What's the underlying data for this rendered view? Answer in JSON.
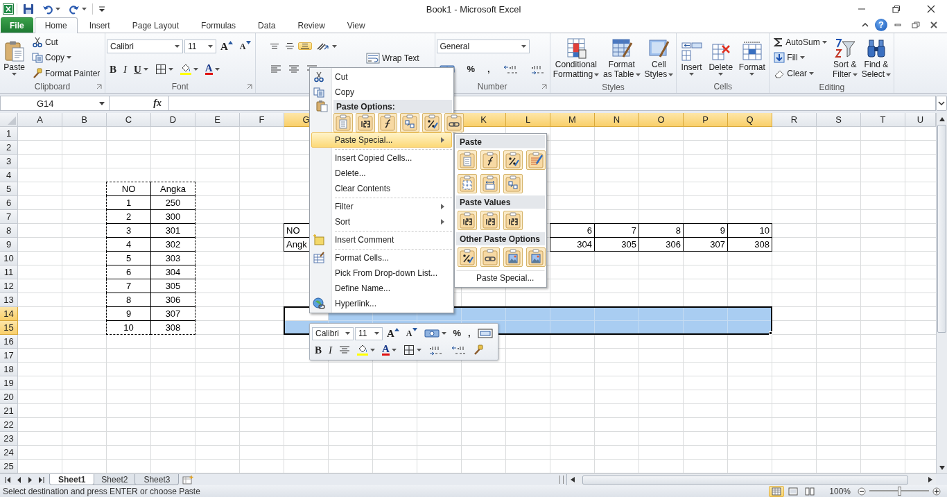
{
  "title_bar": {
    "title": "Book1  -  Microsoft Excel"
  },
  "ribbon_tabs": [
    {
      "label": "File",
      "kind": "file",
      "selected": false
    },
    {
      "label": "Home",
      "kind": "tab",
      "selected": true
    },
    {
      "label": "Insert",
      "kind": "tab",
      "selected": false
    },
    {
      "label": "Page Layout",
      "kind": "tab",
      "selected": false
    },
    {
      "label": "Formulas",
      "kind": "tab",
      "selected": false
    },
    {
      "label": "Data",
      "kind": "tab",
      "selected": false
    },
    {
      "label": "Review",
      "kind": "tab",
      "selected": false
    },
    {
      "label": "View",
      "kind": "tab",
      "selected": false
    }
  ],
  "help_button": "?",
  "ribbon_groups": [
    {
      "label": "Clipboard",
      "launcher": true,
      "columns": [
        [
          [
            {
              "kind": "large",
              "lines": [
                "Paste"
              ],
              "caret": true
            }
          ]
        ],
        [
          [
            {
              "kind": "small",
              "label": "Cut"
            }
          ],
          [
            {
              "kind": "small",
              "label": "Copy",
              "caret": true
            }
          ],
          [
            {
              "kind": "small",
              "label": "Format Painter"
            }
          ]
        ]
      ]
    },
    {
      "label": "Font",
      "launcher": true,
      "columns": [
        [
          [
            {
              "kind": "combo",
              "value": "Calibri"
            },
            {
              "kind": "combo",
              "value": "11"
            },
            {
              "kind": "glyph",
              "label": "A"
            },
            {
              "kind": "glyph",
              "label": "A"
            }
          ],
          [
            {
              "kind": "glyph",
              "label": "B"
            },
            {
              "kind": "glyph",
              "label": "I"
            },
            {
              "kind": "glyph",
              "label": "U",
              "caret": true
            },
            {
              "kind": "icon",
              "caret": true
            },
            {
              "kind": "icon",
              "caret": true
            },
            {
              "kind": "glyph",
              "label": "A",
              "caret": true
            }
          ]
        ]
      ]
    },
    {
      "columns": [
        [
          [
            {
              "kind": "icon",
              "selected": false
            },
            {
              "kind": "icon",
              "selected": false
            },
            {
              "kind": "icon",
              "selected": true
            },
            {
              "kind": "icon",
              "caret": true
            }
          ],
          [
            {
              "kind": "icon"
            },
            {
              "kind": "icon"
            },
            {
              "kind": "icon"
            }
          ]
        ],
        [
          [
            {
              "kind": "small",
              "label": "Wrap Text"
            }
          ]
        ]
      ]
    },
    {
      "label": "Number",
      "launcher": true,
      "columns": [
        [
          [
            {
              "kind": "combo",
              "value": "General"
            }
          ],
          [
            {
              "kind": "icon"
            },
            {
              "kind": "glyph",
              "label": "%"
            },
            {
              "kind": "glyph",
              "label": ","
            },
            {
              "kind": "icon"
            },
            {
              "kind": "icon"
            }
          ]
        ]
      ]
    },
    {
      "label": "Styles",
      "columns": [
        [
          [
            {
              "kind": "large",
              "lines": [
                "Conditional",
                "Formatting"
              ],
              "caret": true
            }
          ]
        ],
        [
          [
            {
              "kind": "large",
              "lines": [
                "Format",
                "as Table"
              ],
              "caret": true
            }
          ]
        ],
        [
          [
            {
              "kind": "large",
              "lines": [
                "Cell",
                "Styles"
              ],
              "caret": true
            }
          ]
        ]
      ]
    },
    {
      "label": "Cells",
      "columns": [
        [
          [
            {
              "kind": "large",
              "lines": [
                "Insert"
              ],
              "caret": true
            }
          ]
        ],
        [
          [
            {
              "kind": "large",
              "lines": [
                "Delete"
              ],
              "caret": true
            }
          ]
        ],
        [
          [
            {
              "kind": "large",
              "lines": [
                "Format"
              ],
              "caret": true
            }
          ]
        ]
      ]
    },
    {
      "label": "Editing",
      "columns": [
        [
          [
            {
              "kind": "small",
              "label": "AutoSum",
              "caret": true
            }
          ],
          [
            {
              "kind": "small",
              "label": "Fill",
              "caret": true
            }
          ],
          [
            {
              "kind": "small",
              "label": "Clear",
              "caret": true
            }
          ]
        ],
        [
          [
            {
              "kind": "large",
              "lines": [
                "Sort &",
                "Filter"
              ],
              "caret": true
            }
          ]
        ],
        [
          [
            {
              "kind": "large",
              "lines": [
                "Find &",
                "Select"
              ],
              "caret": true
            }
          ]
        ]
      ]
    }
  ],
  "formula_bar": {
    "name_box": "G14",
    "function_button": "fx"
  },
  "sheet": {
    "columns": [
      {
        "kind": "header",
        "label": "A",
        "selected": false
      },
      {
        "kind": "header",
        "label": "B",
        "selected": false
      },
      {
        "kind": "header",
        "label": "C",
        "selected": false
      },
      {
        "kind": "header",
        "label": "D",
        "selected": false
      },
      {
        "kind": "header",
        "label": "E",
        "selected": false
      },
      {
        "kind": "header",
        "label": "F",
        "selected": false
      },
      {
        "kind": "header",
        "label": "G",
        "selected": true
      },
      {
        "kind": "covered",
        "selected": true
      },
      {
        "kind": "covered",
        "selected": true
      },
      {
        "kind": "covered",
        "selected": true
      },
      {
        "kind": "header",
        "label": "K",
        "selected": true
      },
      {
        "kind": "header",
        "label": "L",
        "selected": true
      },
      {
        "kind": "header",
        "label": "M",
        "selected": true
      },
      {
        "kind": "header",
        "label": "N",
        "selected": true
      },
      {
        "kind": "header",
        "label": "O",
        "selected": true
      },
      {
        "kind": "header",
        "label": "P",
        "selected": true
      },
      {
        "kind": "header",
        "label": "Q",
        "selected": true
      },
      {
        "kind": "header",
        "label": "R",
        "selected": false
      },
      {
        "kind": "header",
        "label": "S",
        "selected": false
      },
      {
        "kind": "header",
        "label": "T",
        "selected": false
      },
      {
        "kind": "header",
        "label": "U",
        "selected": false
      }
    ],
    "rows": [
      {
        "label": "1",
        "selected": false
      },
      {
        "label": "2",
        "selected": false
      },
      {
        "label": "3",
        "selected": false
      },
      {
        "label": "4",
        "selected": false
      },
      {
        "label": "5",
        "selected": false,
        "cells": {
          "C": {
            "value": "NO",
            "copied": true
          },
          "D": {
            "value": "Angka",
            "copied": true
          }
        }
      },
      {
        "label": "6",
        "selected": false,
        "cells": {
          "C": {
            "value": "1",
            "copied": true
          },
          "D": {
            "value": "250",
            "copied": true
          }
        }
      },
      {
        "label": "7",
        "selected": false,
        "cells": {
          "C": {
            "value": "2",
            "copied": true
          },
          "D": {
            "value": "300",
            "copied": true
          }
        }
      },
      {
        "label": "8",
        "selected": false,
        "cells": {
          "C": {
            "value": "3",
            "copied": true
          },
          "D": {
            "value": "301",
            "copied": true
          },
          "G": {
            "value": "NO"
          },
          "M": {
            "value": "6"
          },
          "N": {
            "value": "7"
          },
          "O": {
            "value": "8"
          },
          "P": {
            "value": "9"
          },
          "Q": {
            "value": "10"
          }
        }
      },
      {
        "label": "9",
        "selected": false,
        "cells": {
          "C": {
            "value": "4",
            "copied": true
          },
          "D": {
            "value": "302",
            "copied": true
          },
          "G": {
            "value": "Angk"
          },
          "M": {
            "value": "304"
          },
          "N": {
            "value": "305"
          },
          "O": {
            "value": "306"
          },
          "P": {
            "value": "307"
          },
          "Q": {
            "value": "308"
          }
        }
      },
      {
        "label": "10",
        "selected": false,
        "cells": {
          "C": {
            "value": "5",
            "copied": true
          },
          "D": {
            "value": "303",
            "copied": true
          }
        }
      },
      {
        "label": "11",
        "selected": false,
        "cells": {
          "C": {
            "value": "6",
            "copied": true
          },
          "D": {
            "value": "304",
            "copied": true
          }
        }
      },
      {
        "label": "12",
        "selected": false,
        "cells": {
          "C": {
            "value": "7",
            "copied": true
          },
          "D": {
            "value": "305",
            "copied": true
          }
        }
      },
      {
        "label": "13",
        "selected": false,
        "cells": {
          "C": {
            "value": "8",
            "copied": true
          },
          "D": {
            "value": "306",
            "copied": true
          }
        }
      },
      {
        "label": "14",
        "selected": true,
        "cells": {
          "C": {
            "value": "9",
            "copied": true
          },
          "D": {
            "value": "307",
            "copied": true
          }
        }
      },
      {
        "label": "15",
        "selected": true,
        "cells": {
          "C": {
            "value": "10",
            "copied": true
          },
          "D": {
            "value": "308",
            "copied": true
          }
        }
      },
      {
        "label": "16",
        "selected": false
      },
      {
        "label": "17",
        "selected": false
      },
      {
        "label": "18",
        "selected": false
      },
      {
        "label": "19",
        "selected": false
      },
      {
        "label": "20",
        "selected": false
      },
      {
        "label": "21",
        "selected": false
      },
      {
        "label": "22",
        "selected": false
      },
      {
        "label": "23",
        "selected": false
      },
      {
        "label": "24",
        "selected": false
      },
      {
        "label": "25",
        "selected": false
      }
    ]
  },
  "context_menu": {
    "items": [
      {
        "kind": "item",
        "label": "Cut",
        "selected": false
      },
      {
        "kind": "item",
        "label": "Copy",
        "selected": false
      },
      {
        "kind": "header",
        "label": "Paste Options:"
      },
      {
        "kind": "paste_icons"
      },
      {
        "kind": "item",
        "label": "Paste Special...",
        "selected": true,
        "submenu": true
      },
      {
        "kind": "separator"
      },
      {
        "kind": "item",
        "label": "Insert Copied Cells...",
        "selected": false
      },
      {
        "kind": "item",
        "label": "Delete...",
        "selected": false
      },
      {
        "kind": "item",
        "label": "Clear Contents",
        "selected": false
      },
      {
        "kind": "separator"
      },
      {
        "kind": "item",
        "label": "Filter",
        "selected": false,
        "submenu": true
      },
      {
        "kind": "item",
        "label": "Sort",
        "selected": false,
        "submenu": true
      },
      {
        "kind": "separator"
      },
      {
        "kind": "item",
        "label": "Insert Comment",
        "selected": false
      },
      {
        "kind": "separator"
      },
      {
        "kind": "item",
        "label": "Format Cells...",
        "selected": false
      },
      {
        "kind": "item",
        "label": "Pick From Drop-down List...",
        "selected": false
      },
      {
        "kind": "item",
        "label": "Define Name...",
        "selected": false
      },
      {
        "kind": "item",
        "label": "Hyperlink...",
        "selected": false
      }
    ]
  },
  "paste_submenu": {
    "sections": [
      {
        "title": "Paste"
      },
      {
        "title": "Paste Values"
      },
      {
        "title": "Other Paste Options"
      }
    ],
    "footer": {
      "label": "Paste Special...",
      "selected": false
    }
  },
  "mini_toolbar": {
    "rows": [
      {
        "items": [
          {
            "kind": "combo",
            "value": "Calibri"
          },
          {
            "kind": "combo",
            "value": "11"
          },
          {
            "kind": "glyph",
            "label": "A"
          },
          {
            "kind": "glyph",
            "label": "A"
          },
          {
            "kind": "icon",
            "caret": true
          },
          {
            "kind": "glyph",
            "label": "%"
          },
          {
            "kind": "glyph",
            "label": ","
          },
          {
            "kind": "icon"
          }
        ]
      },
      {
        "items": [
          {
            "kind": "glyph",
            "label": "B"
          },
          {
            "kind": "glyph",
            "label": "I"
          },
          {
            "kind": "icon"
          },
          {
            "kind": "icon",
            "caret": true
          },
          {
            "kind": "glyph",
            "label": "A",
            "caret": true
          },
          {
            "kind": "icon",
            "caret": true
          },
          {
            "kind": "icon"
          },
          {
            "kind": "icon"
          },
          {
            "kind": "icon"
          }
        ]
      }
    ]
  },
  "sheet_tabs": [
    {
      "label": "Sheet1",
      "selected": true
    },
    {
      "label": "Sheet2",
      "selected": false
    },
    {
      "label": "Sheet3",
      "selected": false
    }
  ],
  "status_bar": {
    "message": "Select destination and press ENTER or choose Paste",
    "view_buttons": [
      {
        "selected": true
      },
      {
        "selected": false
      },
      {
        "selected": false
      }
    ],
    "zoom": {
      "label": "100%",
      "level": 0.5
    }
  }
}
